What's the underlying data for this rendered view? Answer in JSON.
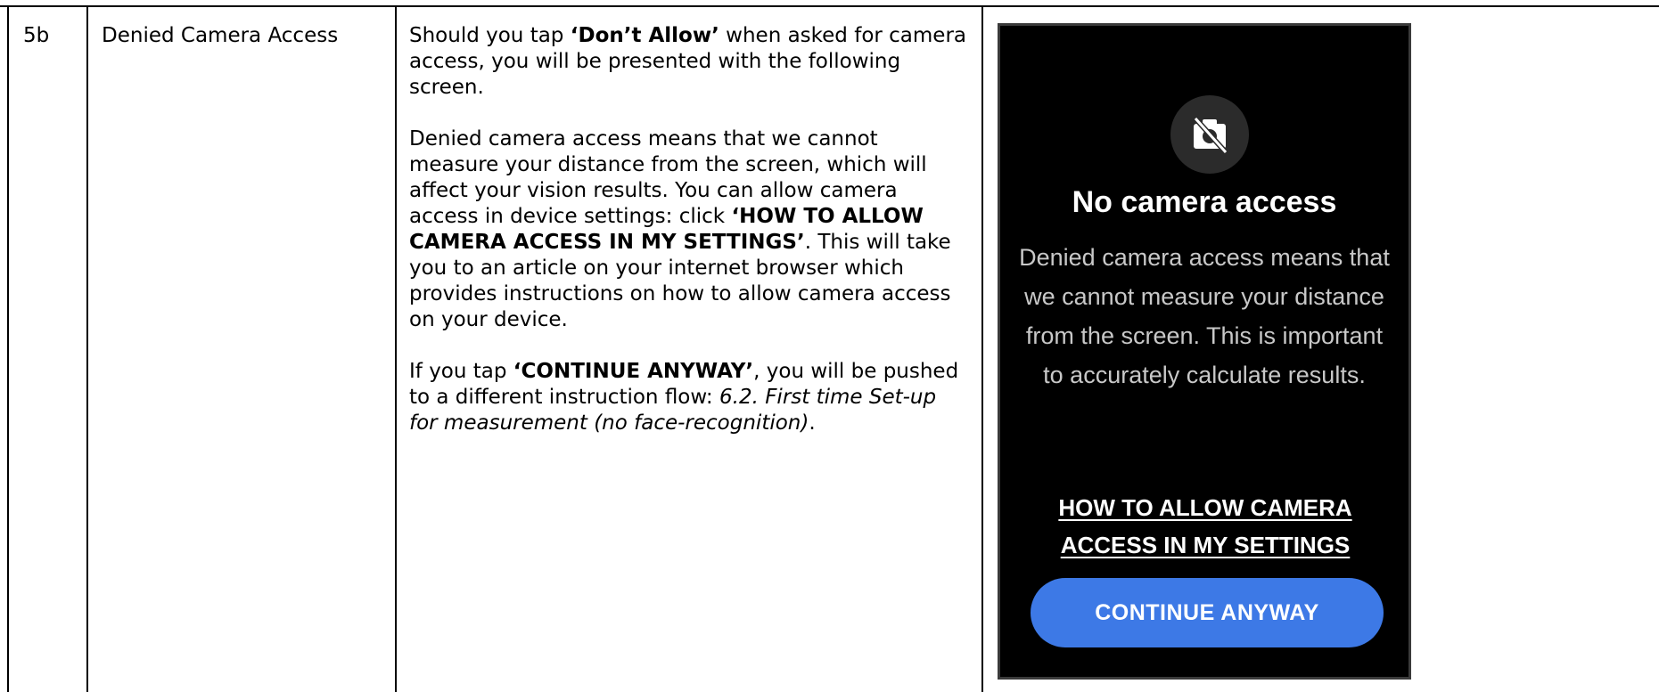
{
  "row": {
    "step": "5b",
    "name": "Denied Camera Access",
    "description": {
      "p1": {
        "t1": "Should you tap ",
        "b1": "‘Don’t Allow’",
        "t2": " when asked for camera access, you will be presented with the following screen."
      },
      "p2": {
        "t1": "Denied camera access means that we cannot measure your distance from the screen, which will affect your vision results. You can allow camera access in device settings: click ",
        "b1": "‘HOW TO ALLOW CAMERA ACCESS IN MY SETTINGS’",
        "t2": ". This will take you to an article on your internet browser which provides instructions on how to allow camera access on your device."
      },
      "p3": {
        "t1": "If you tap ",
        "b1": "‘CONTINUE ANYWAY’",
        "t2": ", you will be pushed to a different instruction flow: ",
        "i1": "6.2. First time Set-up for measurement (no face-recognition)",
        "t3": "."
      }
    },
    "screen": {
      "icon": "camera-off-icon",
      "title": "No camera access",
      "body": "Denied camera access means that we cannot measure your distance from the screen. This is important to accurately calculate results.",
      "link": "HOW TO ALLOW CAMERA ACCESS IN MY SETTINGS",
      "button": "CONTINUE ANYWAY",
      "colors": {
        "background": "#000000",
        "button": "#3d79e6",
        "icon_circle": "#2b2b2b"
      }
    }
  }
}
